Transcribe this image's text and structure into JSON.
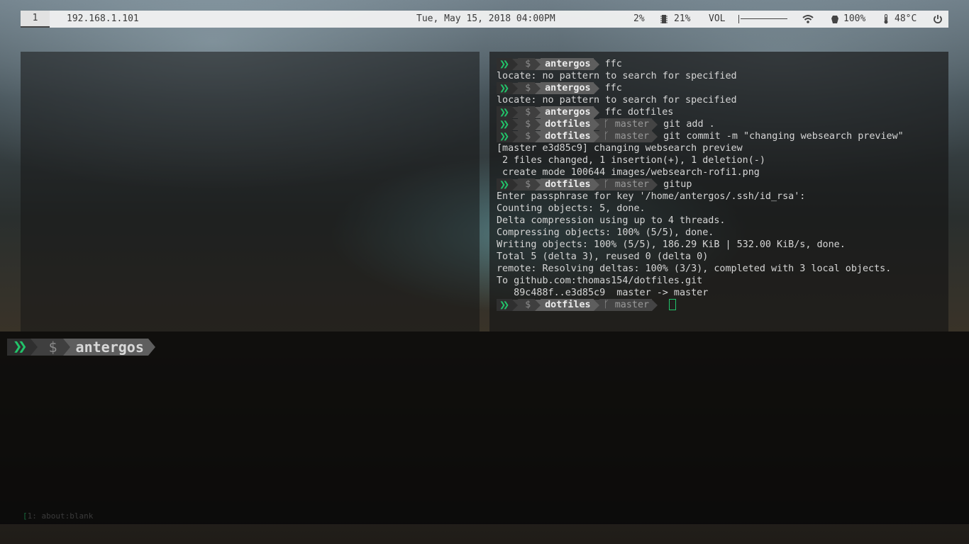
{
  "topbar": {
    "workspace": "1",
    "ip": "192.168.1.101",
    "datetime": "Tue, May 15, 2018 04:00PM",
    "cpu": "2%",
    "memory": "21%",
    "volume_label": "VOL",
    "volume_level": 0.0,
    "battery": "100%",
    "temperature": "48°C",
    "icons": [
      "memory-icon",
      "wifi-icon",
      "battery-icon",
      "thermometer-icon",
      "power-icon"
    ]
  },
  "terminal": {
    "lines": [
      {
        "type": "prompt",
        "dir": "antergos",
        "branch": "",
        "cmd": "ffc"
      },
      {
        "type": "out",
        "text": "locate: no pattern to search for specified"
      },
      {
        "type": "prompt",
        "dir": "antergos",
        "branch": "",
        "cmd": "ffc"
      },
      {
        "type": "out",
        "text": "locate: no pattern to search for specified"
      },
      {
        "type": "prompt",
        "dir": "antergos",
        "branch": "",
        "cmd": "ffc dotfiles"
      },
      {
        "type": "prompt",
        "dir": "dotfiles",
        "branch": "master",
        "cmd": "git add ."
      },
      {
        "type": "prompt",
        "dir": "dotfiles",
        "branch": "master",
        "cmd": "git commit -m \"changing websearch preview\""
      },
      {
        "type": "out",
        "text": "[master e3d85c9] changing websearch preview"
      },
      {
        "type": "out",
        "text": " 2 files changed, 1 insertion(+), 1 deletion(-)"
      },
      {
        "type": "out",
        "text": " create mode 100644 images/websearch-rofi1.png"
      },
      {
        "type": "prompt",
        "dir": "dotfiles",
        "branch": "master",
        "cmd": "gitup"
      },
      {
        "type": "out",
        "text": "Enter passphrase for key '/home/antergos/.ssh/id_rsa':"
      },
      {
        "type": "out",
        "text": "Counting objects: 5, done."
      },
      {
        "type": "out",
        "text": "Delta compression using up to 4 threads."
      },
      {
        "type": "out",
        "text": "Compressing objects: 100% (5/5), done."
      },
      {
        "type": "out",
        "text": "Writing objects: 100% (5/5), 186.29 KiB | 532.00 KiB/s, done."
      },
      {
        "type": "out",
        "text": "Total 5 (delta 3), reused 0 (delta 0)"
      },
      {
        "type": "out",
        "text": "remote: Resolving deltas: 100% (3/3), completed with 3 local objects."
      },
      {
        "type": "out",
        "text": "To github.com:thomas154/dotfiles.git"
      },
      {
        "type": "out",
        "text": "   89c488f..e3d85c9  master -> master"
      },
      {
        "type": "prompt",
        "dir": "dotfiles",
        "branch": "master",
        "cmd": "",
        "cursor": true
      }
    ]
  },
  "prompt": {
    "arrows": "❯❯",
    "dollar": "$",
    "branch_symbol": "ᚴ"
  },
  "bottom": {
    "dir": "antergos",
    "status": "1: about:blank"
  },
  "colors": {
    "accent": "#22c36a",
    "prompt_dark": "#2f2f2f",
    "prompt_mid": "#3f3f3f",
    "prompt_dir": "#5e5e5e"
  }
}
